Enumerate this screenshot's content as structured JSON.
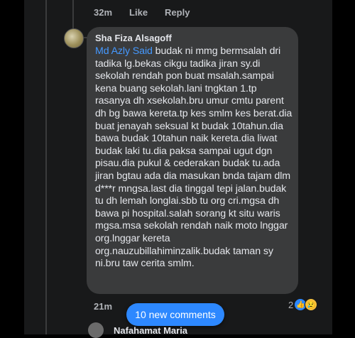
{
  "top_meta": {
    "time": "32m",
    "like": "Like",
    "reply": "Reply"
  },
  "comment": {
    "author": "Sha Fiza Alsagoff",
    "mention": "Md Azly Said",
    "text": " budak ni mmg bermsalah dri tadika lg.bekas cikgu tadika jiran sy.di sekolah rendah pon buat msalah.sampai kena buang sekolah.lani tngktan 1.tp rasanya dh xsekolah.bru umur cmtu parent dh bg bawa kereta.tp kes smlm kes berat.dia buat jenayah seksual kt budak 10tahun.dia bawa budak 10tahun naik kereta.dia liwat budak laki tu.dia paksa sampai ugut dgn pisau.dia pukul & cederakan budak tu.ada jiran bgtau ada dia masukan bnda tajam dlm d***r mngsa.last dia tinggal tepi jalan.budak tu dh lemah longlai.sbb tu org cri.mgsa dh bawa pi hospital.salah sorang kt situ waris mgsa.msa sekolah rendah naik moto lnggar org.lnggar kereta org.nauzubillahiminzalik.budak taman sy ni.bru taw cerita smlm.",
    "time": "21m",
    "reaction_count": "2"
  },
  "new_comments_label": "10 new comments",
  "next_comment_author": "Nafahamat Maria",
  "colors": {
    "accent": "#2d88ff",
    "mention": "#4599ff",
    "bubble": "#3a3b3c",
    "background": "#18191a"
  }
}
